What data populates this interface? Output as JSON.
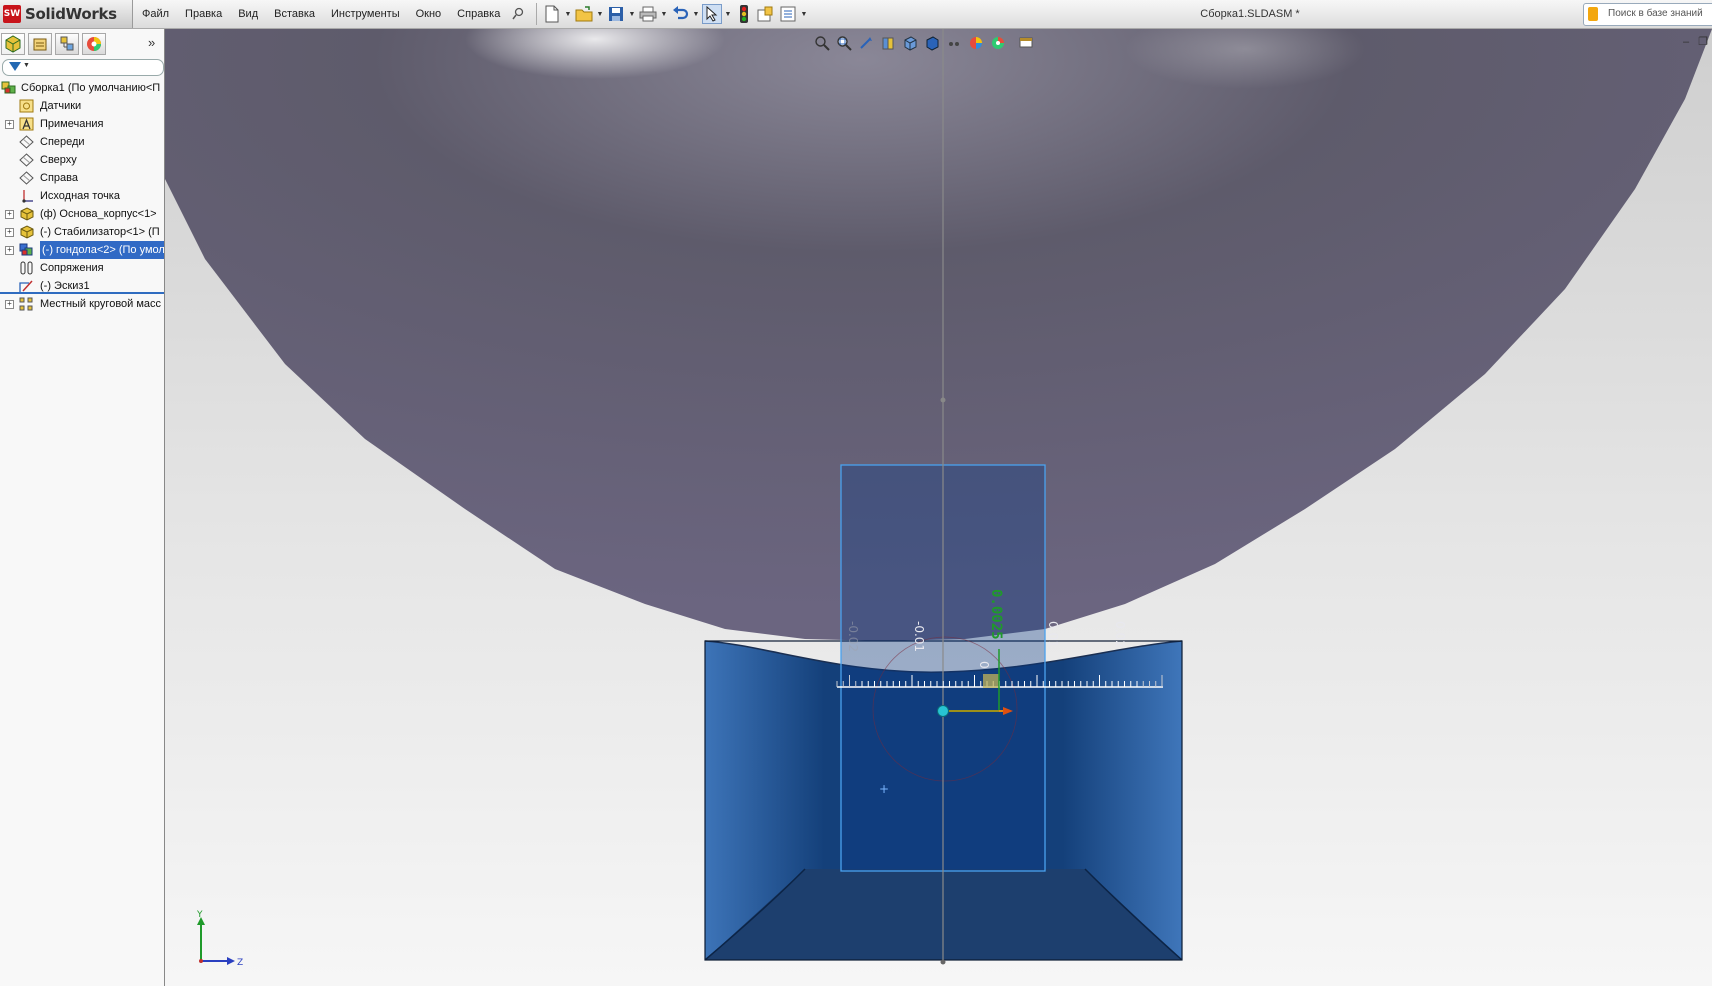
{
  "app": {
    "logo_mark": "SW",
    "logo_text": "SolidWorks",
    "document_title": "Сборка1.SLDASM *"
  },
  "menu": [
    "Файл",
    "Правка",
    "Вид",
    "Вставка",
    "Инструменты",
    "Окно",
    "Справка"
  ],
  "search": {
    "placeholder": "Поиск в базе знаний"
  },
  "feature_tree": {
    "items": [
      {
        "label": "Сборка1  (По умолчанию<П",
        "icon": "assembly-icon",
        "expandable": false,
        "root": true
      },
      {
        "label": "Датчики",
        "icon": "sensors-icon",
        "expandable": false
      },
      {
        "label": "Примечания",
        "icon": "annotations-icon",
        "expandable": true
      },
      {
        "label": "Спереди",
        "icon": "plane-icon",
        "expandable": false
      },
      {
        "label": "Сверху",
        "icon": "plane-icon",
        "expandable": false
      },
      {
        "label": "Справа",
        "icon": "plane-icon",
        "expandable": false
      },
      {
        "label": "Исходная точка",
        "icon": "origin-icon",
        "expandable": false
      },
      {
        "label": "(ф) Основа_корпус<1>",
        "icon": "part-icon",
        "expandable": true
      },
      {
        "label": "(-) Стабилизатор<1> (П",
        "icon": "part-icon",
        "expandable": true
      },
      {
        "label": "(-) гондола<2> (По умол",
        "icon": "subassembly-icon",
        "expandable": true,
        "selected": true
      },
      {
        "label": "Сопряжения",
        "icon": "mates-icon",
        "expandable": false
      },
      {
        "label": "(-) Эскиз1",
        "icon": "sketch-icon",
        "expandable": false
      },
      {
        "label": "Местный круговой масс",
        "icon": "pattern-icon",
        "expandable": true
      }
    ]
  },
  "viewport": {
    "ruler_labels": [
      "-0.02",
      "-0.01",
      "0",
      "0.01",
      "0.02"
    ],
    "ruler_value": "0.0025",
    "triad": {
      "y": "Y",
      "z": "Z"
    }
  },
  "colors": {
    "balloon": "#5f5c6e",
    "gondola": "#2d5d9a",
    "gondola_inner": "#0f3669",
    "highlight": "#3c9be8",
    "ruler_value": "#1f9a2a"
  }
}
